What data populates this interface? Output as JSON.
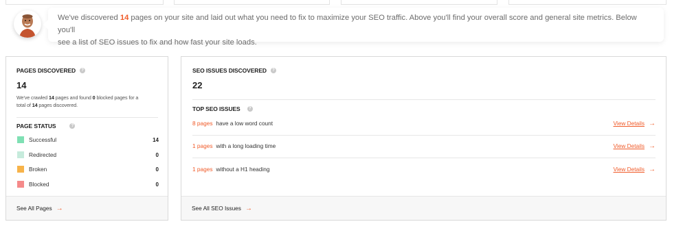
{
  "intro": {
    "text_before": "We've discovered ",
    "pages_count": "14",
    "text_after_line1": " pages on your site and laid out what you need to fix to maximize your SEO traffic. Above you'll find your overall score and general site metrics. Below you'll",
    "text_line2": "see a list of SEO issues to fix and how fast your site loads."
  },
  "pages_discovered": {
    "title": "PAGES DISCOVERED",
    "count": "14",
    "desc_1": "We've crawled ",
    "crawled": "14",
    "desc_2": " pages and found ",
    "blocked": "0",
    "desc_3": " blocked pages for a",
    "desc_4": "total of ",
    "total": "14",
    "desc_5": " pages discovered.",
    "status_title": "PAGE STATUS",
    "statuses": [
      {
        "label": "Successful",
        "value": "14",
        "color": "#7fe0b4"
      },
      {
        "label": "Redirected",
        "value": "0",
        "color": "#c6ebdc"
      },
      {
        "label": "Broken",
        "value": "0",
        "color": "#f7b34a"
      },
      {
        "label": "Blocked",
        "value": "0",
        "color": "#f58a8a"
      }
    ],
    "footer_link": "See All Pages"
  },
  "seo_issues": {
    "title": "SEO ISSUES DISCOVERED",
    "count": "22",
    "top_title": "TOP SEO ISSUES",
    "issues": [
      {
        "count": "8 pages",
        "text": "have a low word count",
        "link": "View Details"
      },
      {
        "count": "1 pages",
        "text": "with a long loading time",
        "link": "View Details"
      },
      {
        "count": "1 pages",
        "text": "without a H1 heading",
        "link": "View Details"
      }
    ],
    "footer_link": "See All SEO Issues"
  },
  "colors": {
    "accent": "#f05a28"
  }
}
